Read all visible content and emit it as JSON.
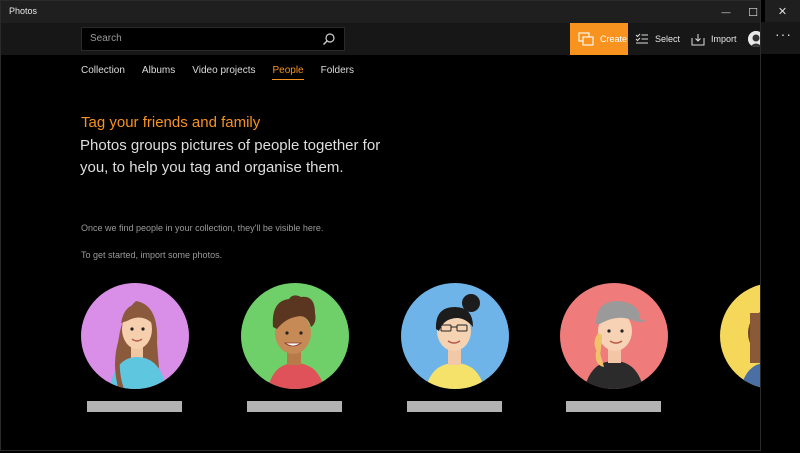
{
  "window": {
    "title": "Photos",
    "minimize_glyph": "—",
    "maximize_glyph": "☐",
    "close_glyph": "✕"
  },
  "search": {
    "placeholder": "Search",
    "icon": "search-icon"
  },
  "commands": {
    "create_label": "Create",
    "select_label": "Select",
    "import_label": "Import",
    "more_glyph": "···",
    "accent": "#f7931e"
  },
  "nav": {
    "items": [
      {
        "label": "Collection",
        "active": false
      },
      {
        "label": "Albums",
        "active": false
      },
      {
        "label": "Video projects",
        "active": false
      },
      {
        "label": "People",
        "active": true
      },
      {
        "label": "Folders",
        "active": false
      }
    ]
  },
  "main": {
    "headline": "Tag your friends and family",
    "subheadline": "Photos groups pictures of people together for you, to help you tag and organise them.",
    "info_line1": "Once we find people in your collection, they'll be visible here.",
    "info_line2": "To get started, import some photos."
  },
  "people": [
    {
      "icon": "person-long-hair-icon",
      "bg": "#d98fe8"
    },
    {
      "icon": "person-curly-hair-icon",
      "bg": "#6fd06a"
    },
    {
      "icon": "person-bun-hair-icon",
      "bg": "#6fb4e8"
    },
    {
      "icon": "person-cap-icon",
      "bg": "#ef7b7b"
    },
    {
      "icon": "person-partial-icon",
      "bg": "#f5d75a"
    }
  ]
}
